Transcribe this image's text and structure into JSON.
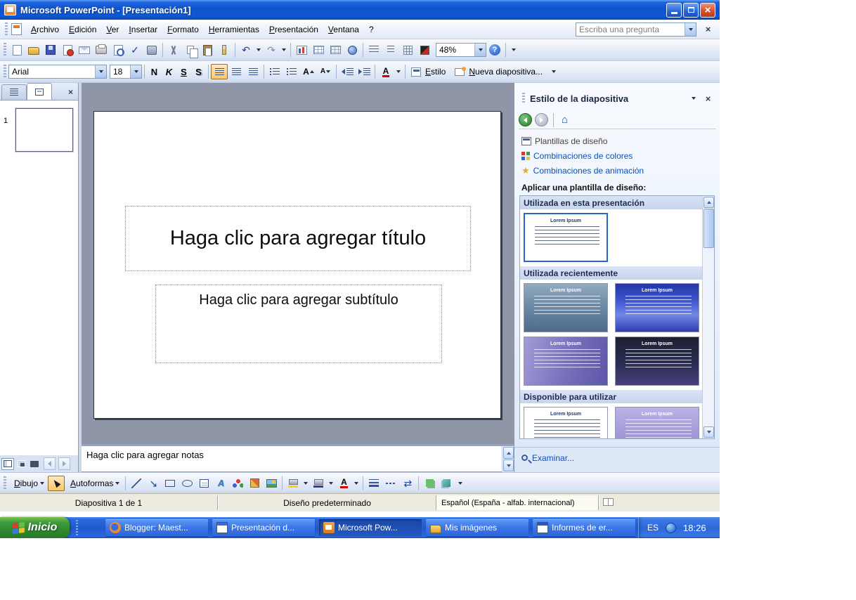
{
  "window": {
    "title": "Microsoft PowerPoint - [Presentación1]"
  },
  "menubar": {
    "items": [
      "Archivo",
      "Edición",
      "Ver",
      "Insertar",
      "Formato",
      "Herramientas",
      "Presentación",
      "Ventana",
      "?"
    ],
    "question_placeholder": "Escriba una pregunta"
  },
  "standard_toolbar": {
    "zoom": "48%"
  },
  "formatting_toolbar": {
    "font": "Arial",
    "size": "18",
    "bold": "N",
    "italic": "K",
    "underline": "S",
    "shadow": "S",
    "style": "Estilo",
    "new_slide": "Nueva diapositiva..."
  },
  "slides_panel": {
    "slide_number": "1"
  },
  "slide": {
    "title_placeholder": "Haga clic para agregar título",
    "subtitle_placeholder": "Haga clic para agregar subtítulo"
  },
  "notes": {
    "placeholder": "Haga clic para agregar notas"
  },
  "task_pane": {
    "title": "Estilo de la diapositiva",
    "links": [
      "Plantillas de diseño",
      "Combinaciones de colores",
      "Combinaciones de animación"
    ],
    "apply_label": "Aplicar una plantilla de diseño:",
    "sections": [
      "Utilizada en esta presentación",
      "Utilizada recientemente",
      "Disponible para utilizar"
    ],
    "browse": "Examinar...",
    "design_thumb_title": "Lorem Ipsum"
  },
  "drawing_toolbar": {
    "draw": "Dibujo",
    "autoshapes": "Autoformas"
  },
  "status_bar": {
    "slide_info": "Diapositiva 1 de 1",
    "design_name": "Diseño predeterminado",
    "language": "Español (España - alfab. internacional)"
  },
  "taskbar": {
    "start": "Inicio",
    "buttons": [
      "Blogger: Maest...",
      "Presentación d...",
      "Microsoft Pow...",
      "Mis imágenes",
      "Informes de er..."
    ],
    "language_indicator": "ES",
    "time": "18:26"
  },
  "icons": {
    "close": "×",
    "undo": "↶",
    "redo": "↷",
    "help": "?",
    "home": "⌂",
    "star": "★",
    "letter_a": "A",
    "spell_check": "✓",
    "arrow_diag": "↘",
    "arrows_swap": "⇄"
  },
  "colors": {
    "titlebar_blue": "#0d53cd",
    "taskbar_blue": "#2159cd",
    "start_green": "#3f9c3f",
    "toolbar_face": "#d7e2f3",
    "slide_area_gray": "#8f96a7",
    "selection_border_blue": "#2a66c9",
    "link_blue": "#0b50bb",
    "active_toggle_orange": "#fcc86a"
  }
}
